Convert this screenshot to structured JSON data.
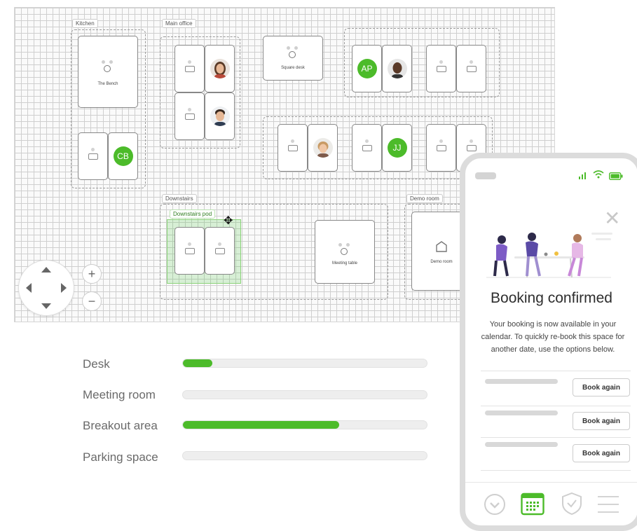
{
  "floorplan": {
    "zones": {
      "kitchen": "Kitchen",
      "main_office": "Main office",
      "downstairs": "Downstairs",
      "demo_room": "Demo room",
      "downstairs_pod": "Downstairs pod"
    },
    "tables": {
      "bench": "The Bench",
      "square_desk": "Square desk",
      "meeting_table": "Meeting table",
      "demo_room": "Demo room"
    },
    "avatars": {
      "cb": "CB",
      "ap": "AP",
      "jj": "JJ"
    },
    "accent_color": "#4cbb2a"
  },
  "navigation": {
    "zoom_in": "+",
    "zoom_out": "−"
  },
  "space_types": [
    {
      "label": "Desk",
      "progress": 0.12
    },
    {
      "label": "Meeting room",
      "progress": 0
    },
    {
      "label": "Breakout area",
      "progress": 0.64
    },
    {
      "label": "Parking space",
      "progress": 0
    }
  ],
  "phone": {
    "title": "Booking confirmed",
    "body": "Your booking is now available in your calendar. To quickly re-book this space for another date, use the options below.",
    "book_again": [
      "Book again",
      "Book again",
      "Book again"
    ],
    "tabs": [
      "check-circle-icon",
      "calendar-icon",
      "shield-check-icon",
      "menu-icon"
    ]
  }
}
